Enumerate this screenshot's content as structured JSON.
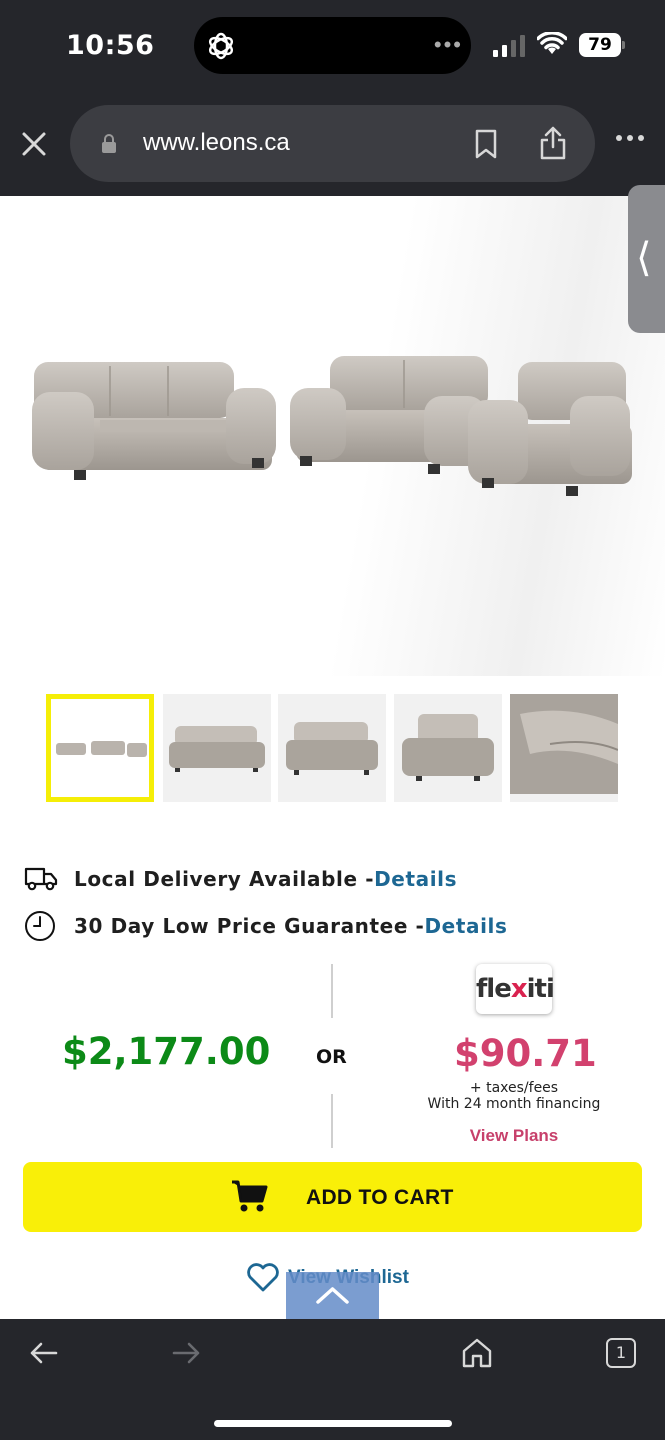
{
  "status_bar": {
    "time": "10:56",
    "battery": "79"
  },
  "browser": {
    "url": "www.leons.ca"
  },
  "hero": {
    "product_image": "grey-leather-sofa-loveseat-chair-set"
  },
  "features": [
    {
      "text": "Local Delivery Available - ",
      "link": "Details",
      "icon": "truck-icon"
    },
    {
      "text": "30 Day Low Price Guarantee - ",
      "link": "Details",
      "icon": "clock-icon"
    }
  ],
  "pricing": {
    "price": "$2,177.00",
    "or_label": "OR",
    "financing_brand": "flexiti",
    "monthly_price": "$90.71",
    "taxes_note": "+ taxes/fees",
    "financing_note": "With 24 month financing",
    "view_plans": "View Plans"
  },
  "actions": {
    "add_to_cart": "ADD TO CART",
    "view_wishlist": "View Wishlist"
  },
  "bottom_nav": {
    "tabs_count": "1"
  },
  "colors": {
    "price_green": "#0c8a17",
    "flexiti_pink": "#d2416e",
    "link_blue": "#1d6793",
    "cart_yellow": "#f9ef08"
  }
}
